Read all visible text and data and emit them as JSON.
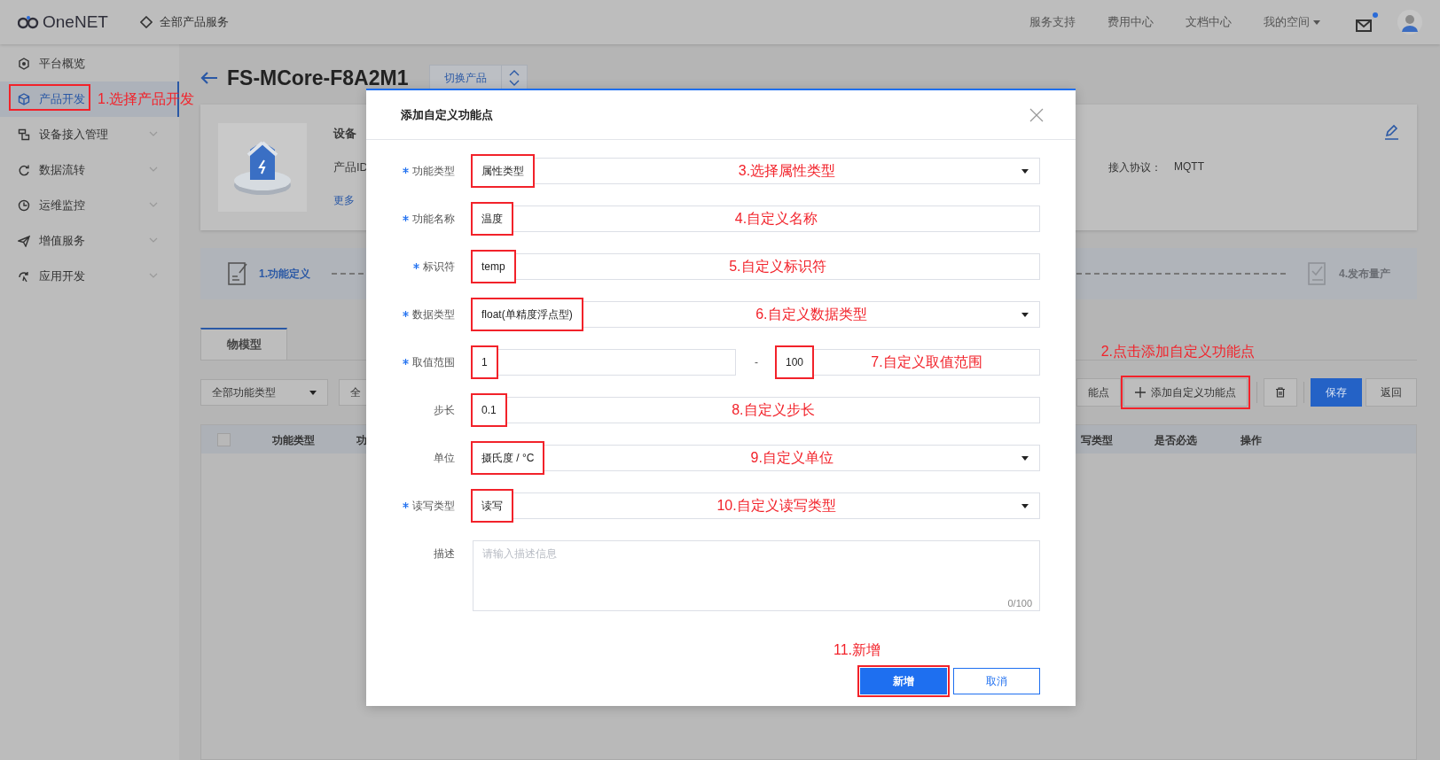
{
  "topbar": {
    "logo": "OneNET",
    "all_products": "全部产品服务",
    "links": [
      "服务支持",
      "费用中心",
      "文档中心",
      "我的空间"
    ],
    "mail_unread": true
  },
  "sidebar": {
    "items": [
      {
        "label": "平台概览",
        "selected": false,
        "has_children": false
      },
      {
        "label": "产品开发",
        "selected": true,
        "has_children": false,
        "highlighted": true,
        "annotation": "1.选择产品开发"
      },
      {
        "label": "设备接入管理",
        "selected": false,
        "has_children": true
      },
      {
        "label": "数据流转",
        "selected": false,
        "has_children": true
      },
      {
        "label": "运维监控",
        "selected": false,
        "has_children": true
      },
      {
        "label": "增值服务",
        "selected": false,
        "has_children": true
      },
      {
        "label": "应用开发",
        "selected": false,
        "has_children": true
      }
    ]
  },
  "product": {
    "title": "FS-MCore-F8A2M1",
    "switch_label": "切换产品",
    "info_title": "设备",
    "info_label": "产品ID",
    "more_link": "更多",
    "protocol_label": "接入协议：",
    "protocol_value": "MQTT"
  },
  "steps": [
    {
      "label": "1.功能定义",
      "selected": true
    },
    {
      "label": "4.发布量产",
      "selected": false
    }
  ],
  "tabs": [
    {
      "label": "物模型",
      "selected": true
    }
  ],
  "filters": [
    "全部功能类型",
    "全"
  ],
  "toolbar": {
    "partial_button": "能点",
    "add_button": "添加自定义功能点",
    "add_highlighted": true,
    "annotation": "2.点击添加自定义功能点",
    "save": "保存",
    "back": "返回"
  },
  "table": {
    "select_all_checked": false,
    "columns": [
      "功能类型",
      "功",
      "写类型",
      "是否必选",
      "操作"
    ]
  },
  "dialog": {
    "title": "添加自定义功能点",
    "fields": [
      {
        "kind": "select",
        "label": "功能类型",
        "required": true,
        "value": "属性类型",
        "highlighted": true,
        "annotation": "3.选择属性类型"
      },
      {
        "kind": "text",
        "label": "功能名称",
        "required": true,
        "value": "温度",
        "highlighted": true,
        "annotation": "4.自定义名称"
      },
      {
        "kind": "text",
        "label": "标识符",
        "required": true,
        "value": "temp",
        "highlighted": true,
        "annotation": "5.自定义标识符"
      },
      {
        "kind": "select",
        "label": "数据类型",
        "required": true,
        "value": "float(单精度浮点型)",
        "highlighted": true,
        "annotation": "6.自定义数据类型"
      },
      {
        "kind": "range",
        "label": "取值范围",
        "required": true,
        "min": "1",
        "separator": "-",
        "max": "100",
        "highlighted": true,
        "annotation": "7.自定义取值范围"
      },
      {
        "kind": "text",
        "label": "步长",
        "required": false,
        "value": "0.1",
        "highlighted": true,
        "annotation": "8.自定义步长"
      },
      {
        "kind": "select",
        "label": "单位",
        "required": false,
        "value": "摄氏度 / °C",
        "highlighted": true,
        "annotation": "9.自定义单位"
      },
      {
        "kind": "select",
        "label": "读写类型",
        "required": true,
        "value": "读写",
        "highlighted": true,
        "annotation": "10.自定义读写类型"
      },
      {
        "kind": "textarea",
        "label": "描述",
        "required": false,
        "placeholder": "请输入描述信息",
        "counter": "0/100"
      }
    ],
    "annotation": "11.新增",
    "buttons": [
      {
        "label": "新增",
        "primary": true,
        "highlighted": true
      },
      {
        "label": "取消",
        "primary": false,
        "highlighted": false
      }
    ]
  }
}
